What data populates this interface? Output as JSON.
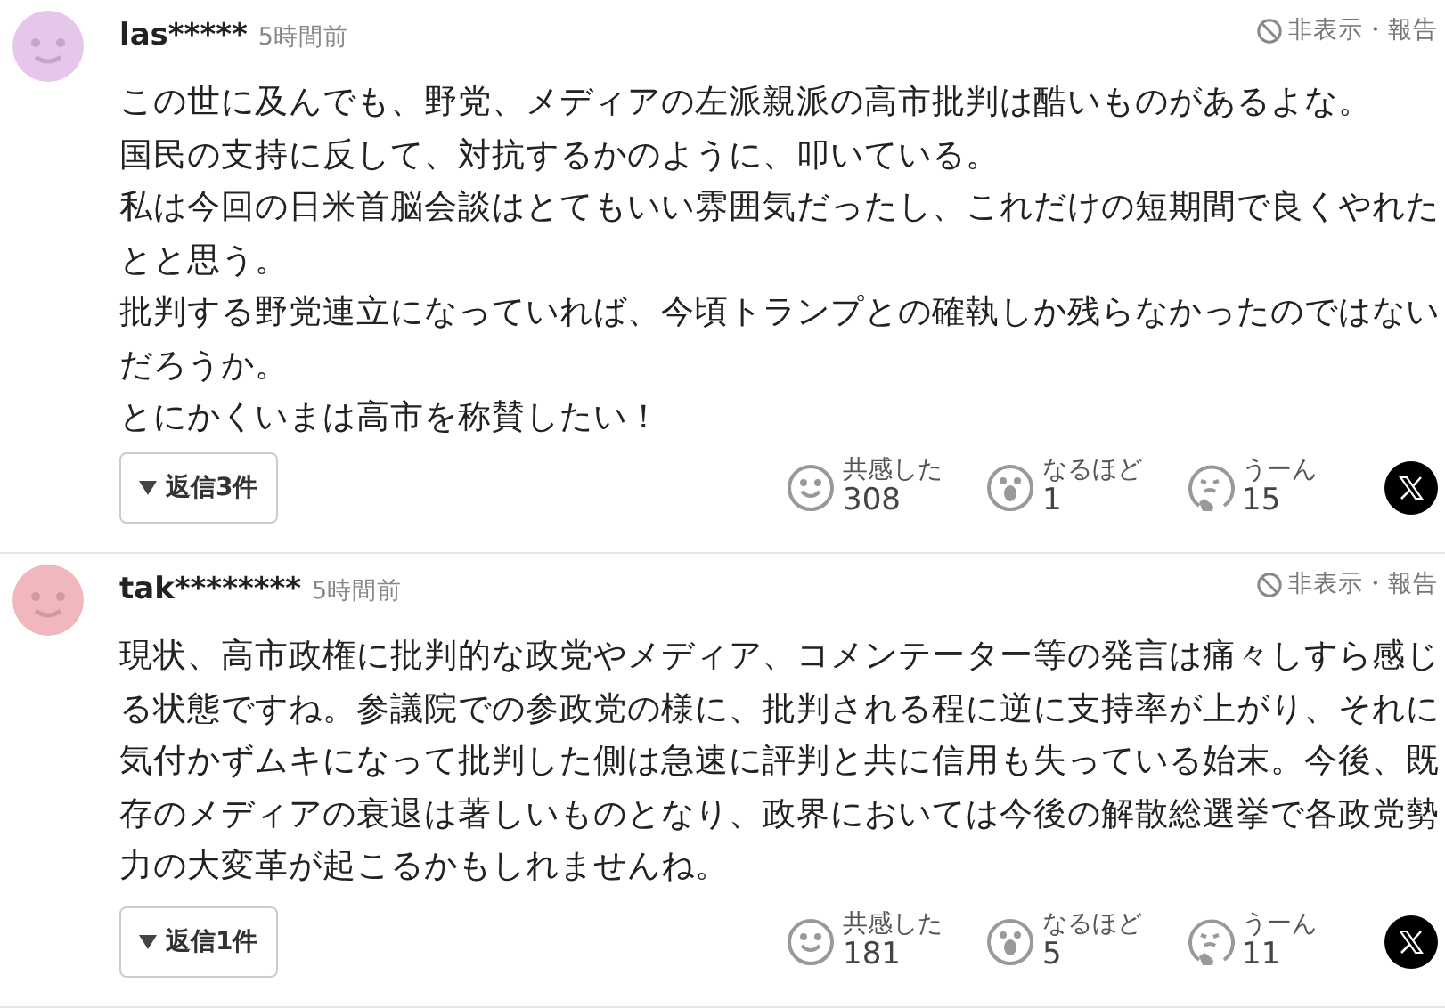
{
  "comments": [
    {
      "user": "las*****",
      "time": "5時間前",
      "color": "#e6c6ea",
      "hide_report": "非表示・報告",
      "body": [
        "この世に及んでも、野党、メディアの左派親派の高市批判は酷いものがあるよな。",
        "国民の支持に反して、対抗するかのように、叩いている。",
        "私は今回の日米首脳会談はとてもいい雰囲気だったし、これだけの短期間で良くやれたとと思う。",
        "批判する野党連立になっていれば、今頃トランプとの確執しか残らなかったのではないだろうか。",
        "とにかくいまは高市を称賛したい！"
      ],
      "reply": "返信3件",
      "reactions": [
        {
          "kind": "empathy",
          "label": "共感した",
          "count": "308"
        },
        {
          "kind": "insight",
          "label": "なるほど",
          "count": "1"
        },
        {
          "kind": "doubt",
          "label": "うーん",
          "count": "15"
        }
      ]
    },
    {
      "user": "tak********",
      "time": "5時間前",
      "color": "#f0b8bd",
      "hide_report": "非表示・報告",
      "body": [
        "現状、高市政権に批判的な政党やメディア、コメンテーター等の発言は痛々しすら感じる状態ですね。参議院での参政党の様に、批判される程に逆に支持率が上がり、それに気付かずムキになって批判した側は急速に評判と共に信用も失っている始末。今後、既存のメディアの衰退は著しいものとなり、政界においては今後の解散総選挙で各政党勢力の大変革が起こるかもしれませんね。"
      ],
      "reply": "返信1件",
      "reactions": [
        {
          "kind": "empathy",
          "label": "共感した",
          "count": "181"
        },
        {
          "kind": "insight",
          "label": "なるほど",
          "count": "5"
        },
        {
          "kind": "doubt",
          "label": "うーん",
          "count": "11"
        }
      ]
    }
  ]
}
